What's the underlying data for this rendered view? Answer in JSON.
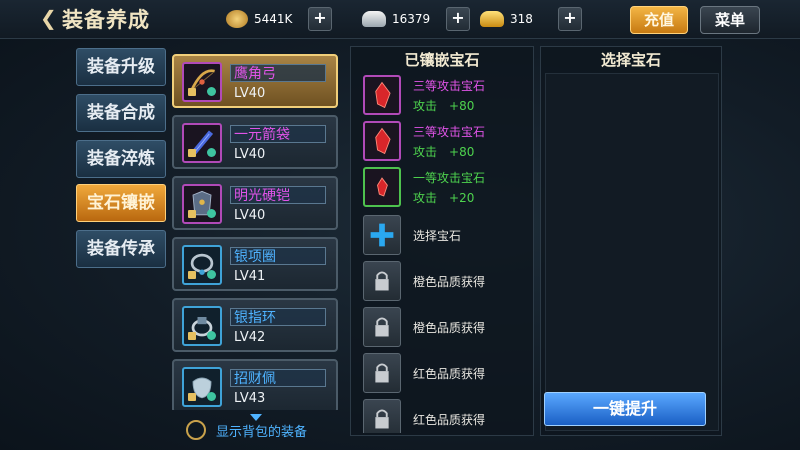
{
  "header": {
    "back_glyph": "❮",
    "title": "装备养成",
    "copper": "5441K",
    "silver": "16379",
    "gold": "318",
    "plus": "+",
    "recharge": "充值",
    "menu": "菜单"
  },
  "nav": [
    "装备升级",
    "装备合成",
    "装备淬炼",
    "宝石镶嵌",
    "装备传承"
  ],
  "equipment": [
    {
      "name": "鹰角弓",
      "level": "LV40",
      "name_color": "#e054e8",
      "icon": "bow-icon"
    },
    {
      "name": "一元箭袋",
      "level": "LV40",
      "name_color": "#e054e8",
      "icon": "quiver-icon"
    },
    {
      "name": "明光硬铠",
      "level": "LV40",
      "name_color": "#e054e8",
      "icon": "armor-icon"
    },
    {
      "name": "银项圈",
      "level": "LV41",
      "name_color": "#4fb3ff",
      "icon": "necklace-icon"
    },
    {
      "name": "银指环",
      "level": "LV42",
      "name_color": "#4fb3ff",
      "icon": "ring-icon"
    },
    {
      "name": "招财佩",
      "level": "LV43",
      "name_color": "#4fb3ff",
      "icon": "pendant-icon"
    }
  ],
  "show_bag_label": "显示背包的装备",
  "inlaid": {
    "title": "已镶嵌宝石",
    "gems": [
      {
        "name": "三等攻击宝石",
        "stat": "攻击",
        "value": "+80",
        "color": "purple"
      },
      {
        "name": "三等攻击宝石",
        "stat": "攻击",
        "value": "+80",
        "color": "purple"
      },
      {
        "name": "一等攻击宝石",
        "stat": "攻击",
        "value": "+20",
        "color": "green"
      }
    ],
    "select_label": "选择宝石",
    "locked": [
      "橙色品质获得",
      "橙色品质获得",
      "红色品质获得",
      "红色品质获得"
    ]
  },
  "choose": {
    "title": "选择宝石",
    "button": "一键提升"
  }
}
